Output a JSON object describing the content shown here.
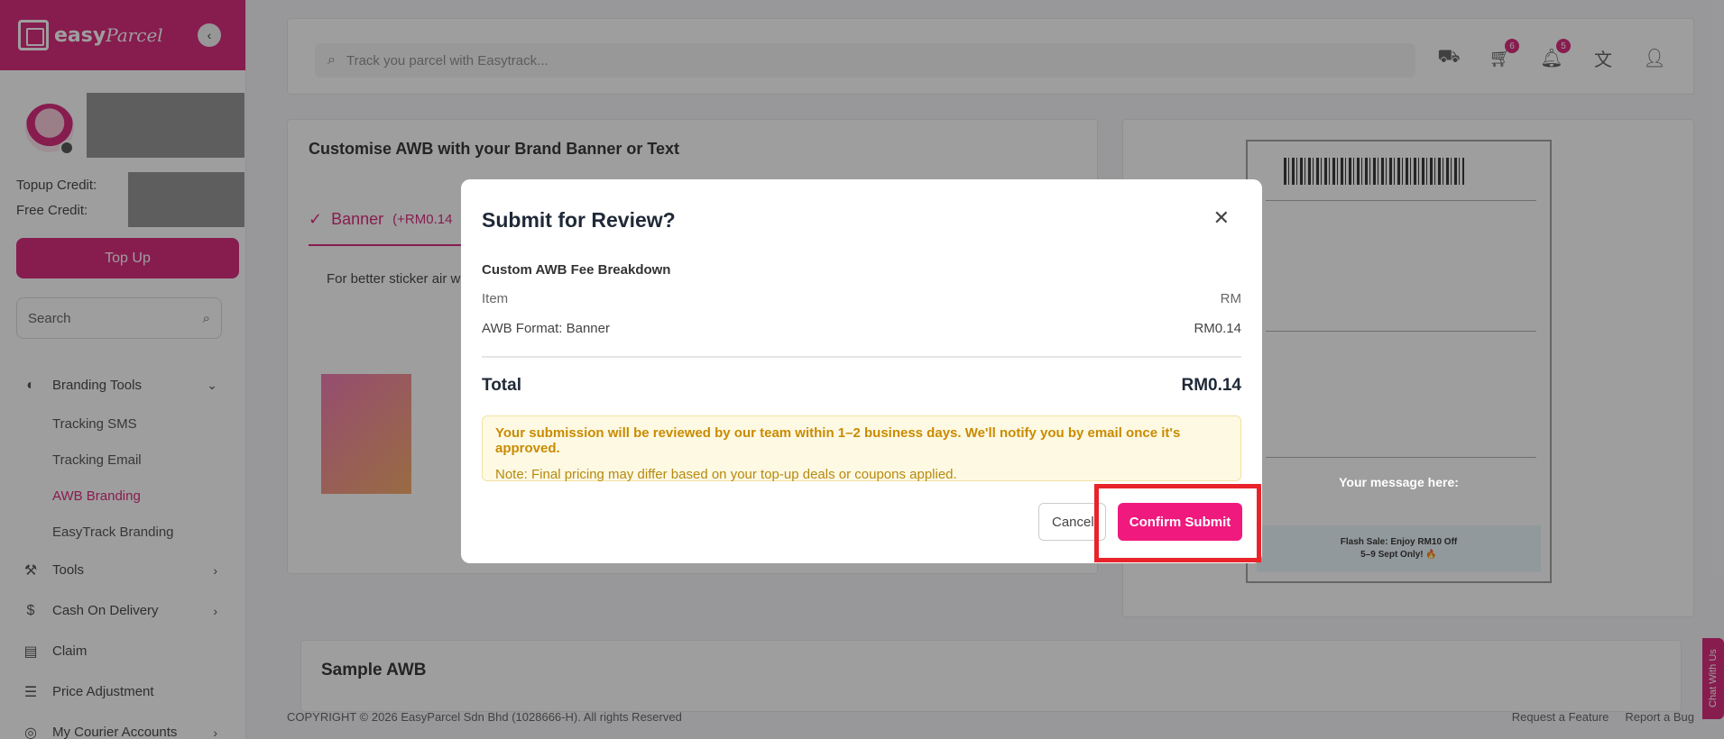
{
  "brand": {
    "logo_text": "easy",
    "logo_script": "Parcel",
    "accent": "#d6136f"
  },
  "sidebar": {
    "topup_credit_label": "Topup Credit:",
    "free_credit_label": "Free Credit:",
    "topup_button": "Top Up",
    "search_placeholder": "Search",
    "nav": [
      {
        "label": "Branding Tools",
        "icon": "palette-icon"
      },
      {
        "label": "Tools",
        "icon": "wrench-icon"
      },
      {
        "label": "Cash On Delivery",
        "icon": "dollar-icon"
      },
      {
        "label": "Claim",
        "icon": "document-icon"
      },
      {
        "label": "Price Adjustment",
        "icon": "sliders-icon"
      },
      {
        "label": "My Courier Accounts",
        "icon": "globe-icon"
      }
    ],
    "sub_items": [
      "Tracking SMS",
      "Tracking Email",
      "AWB Branding",
      "EasyTrack Branding"
    ]
  },
  "topbar": {
    "track_placeholder": "Track you parcel with Easytrack...",
    "cart_badge": "6",
    "bell_badge": "5"
  },
  "main": {
    "card_title": "Customise AWB with your Brand Banner or Text",
    "tab_label": "Banner",
    "tab_price": "(+RM0.14",
    "hint": "For better sticker air w",
    "sample_title": "Sample AWB"
  },
  "preview": {
    "message": "Your message here:",
    "flash_line1": "Flash Sale: Enjoy RM10 Off",
    "flash_line2": "5–9 Sept Only! 🔥"
  },
  "modal": {
    "title": "Submit for Review?",
    "section_title": "Custom AWB Fee Breakdown",
    "col_item": "Item",
    "col_rm": "RM",
    "line_item": "AWB Format: Banner",
    "line_price": "RM0.14",
    "total_label": "Total",
    "total_value": "RM0.14",
    "notice_bold": "Your submission will be reviewed by our team within 1–2 business days. We'll notify you by email once it's approved.",
    "notice_note": "Note: Final pricing may differ based on your top-up deals or coupons applied.",
    "cancel": "Cancel",
    "confirm": "Confirm Submit"
  },
  "footer": {
    "copyright": "COPYRIGHT © 2026 EasyParcel Sdn Bhd (1028666-H). All rights Reserved",
    "request_feature": "Request a Feature",
    "report_bug": "Report a Bug"
  },
  "chat_tab": "Chat With Us"
}
